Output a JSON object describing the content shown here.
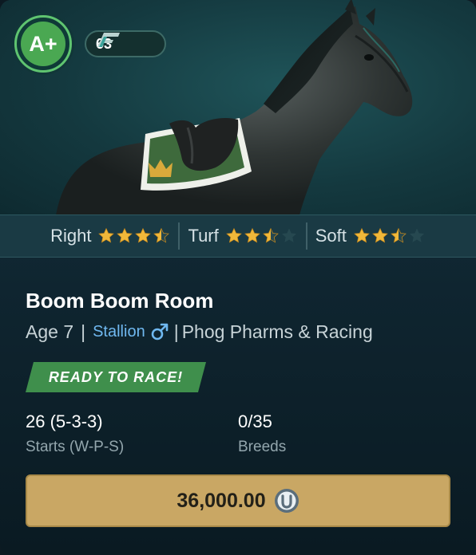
{
  "horse": {
    "grade": "A+",
    "speed_rating": "63",
    "name": "Boom Boom Room",
    "age": "Age 7",
    "gender": "Stallion",
    "stable": "Phog Pharms & Racing",
    "status": "READY TO RACE!"
  },
  "attributes": [
    {
      "label": "Right",
      "rating": 3.5,
      "max": 4
    },
    {
      "label": "Turf",
      "rating": 2.5,
      "max": 4
    },
    {
      "label": "Soft",
      "rating": 2.5,
      "max": 4
    }
  ],
  "stats": {
    "starts_value": "26 (5-3-3)",
    "starts_caption": "Starts (W-P-S)",
    "breeds_value": "0/35",
    "breeds_caption": "Breeds"
  },
  "price": {
    "amount": "36,000.00",
    "currency_icon": "coin-icon"
  },
  "colors": {
    "grade_green": "#4aa852",
    "star_gold": "#f0b83a",
    "star_empty": "#264850",
    "status_green": "#3f8f4c",
    "price_gold": "#c9a764",
    "gender_blue": "#6fb8f0"
  }
}
